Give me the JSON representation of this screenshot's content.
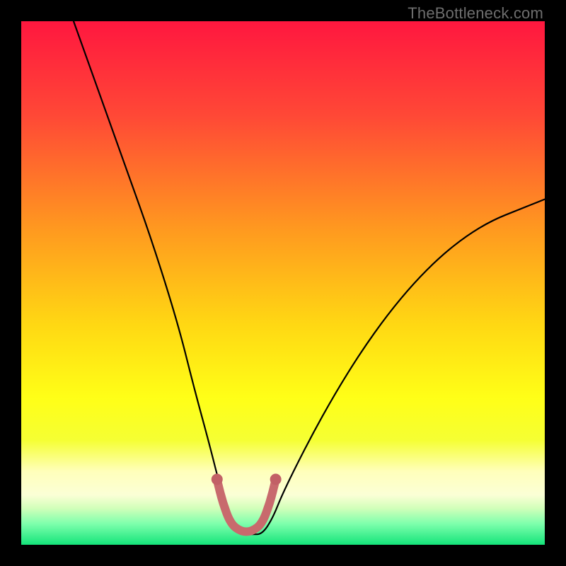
{
  "watermark": "TheBottleneck.com",
  "colors": {
    "frame": "#000000",
    "watermark": "#6e6e6e",
    "curve": "#000000",
    "highlight": "#c86a6d",
    "highlight_dot": "#c26066",
    "gradient_stops": [
      {
        "offset": 0.0,
        "color": "#ff173f"
      },
      {
        "offset": 0.18,
        "color": "#ff4836"
      },
      {
        "offset": 0.4,
        "color": "#ff9a1f"
      },
      {
        "offset": 0.58,
        "color": "#ffd813"
      },
      {
        "offset": 0.72,
        "color": "#ffff17"
      },
      {
        "offset": 0.8,
        "color": "#f5ff33"
      },
      {
        "offset": 0.86,
        "color": "#ffffbb"
      },
      {
        "offset": 0.905,
        "color": "#fbffd6"
      },
      {
        "offset": 0.93,
        "color": "#d2ffba"
      },
      {
        "offset": 0.96,
        "color": "#7dffac"
      },
      {
        "offset": 1.0,
        "color": "#14e47a"
      }
    ]
  },
  "chart_data": {
    "type": "line",
    "title": "",
    "xlabel": "",
    "ylabel": "",
    "xlim": [
      0,
      100
    ],
    "ylim": [
      0,
      100
    ],
    "series": [
      {
        "name": "bottleneck-curve",
        "x": [
          10,
          15,
          20,
          25,
          30,
          33,
          36,
          38,
          40,
          42,
          44,
          46,
          48,
          50,
          55,
          60,
          65,
          70,
          75,
          80,
          85,
          90,
          95,
          100
        ],
        "y": [
          100,
          86,
          72,
          58,
          42,
          30,
          19,
          11,
          5,
          2,
          2,
          2,
          5,
          10,
          20,
          29,
          37,
          44,
          50,
          55,
          59,
          62,
          64,
          66
        ]
      }
    ],
    "highlight_segment": {
      "name": "valley-floor",
      "x": [
        37.5,
        38.5,
        40,
        42,
        44,
        46,
        47.5,
        48.5
      ],
      "y": [
        12,
        8,
        4,
        2.5,
        2.5,
        4,
        8,
        12
      ]
    },
    "highlight_dots": {
      "name": "valley-endpoints",
      "points": [
        {
          "x": 37.4,
          "y": 12.5
        },
        {
          "x": 48.6,
          "y": 12.5
        }
      ]
    }
  }
}
